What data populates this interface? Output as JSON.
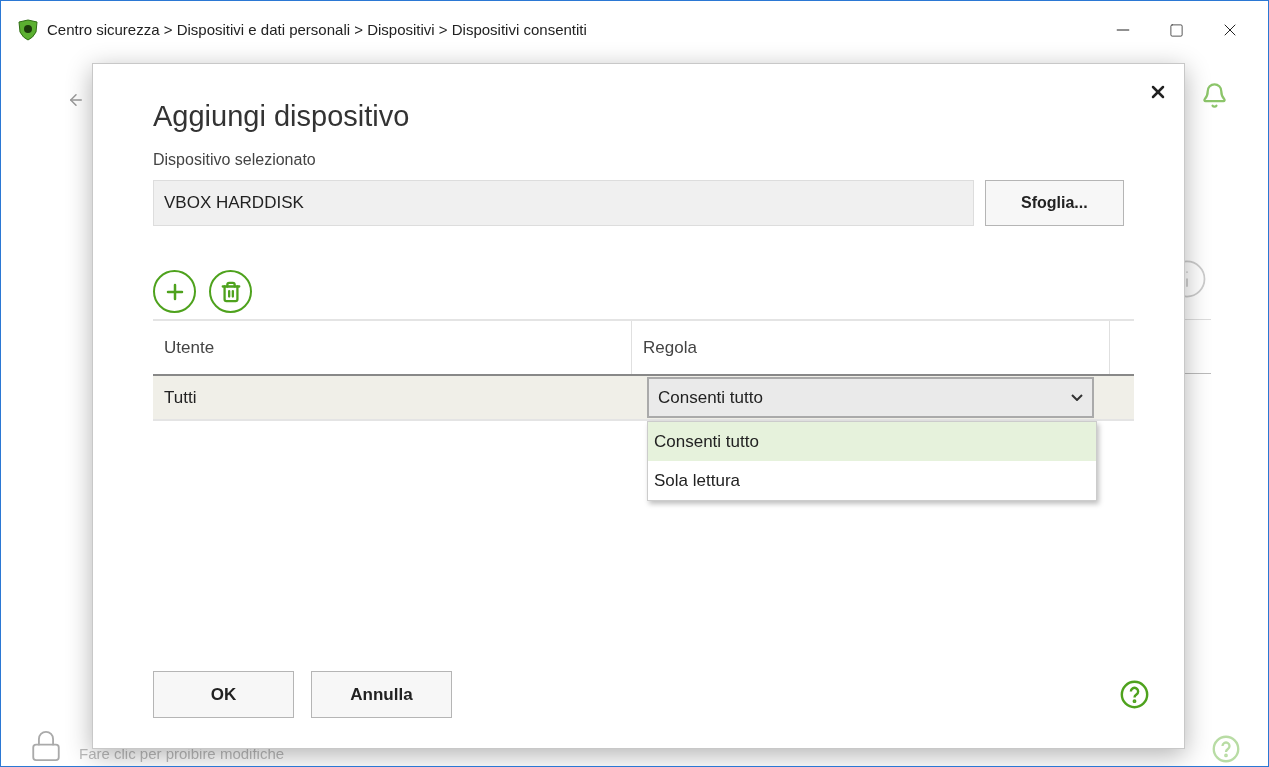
{
  "window": {
    "title": "Centro sicurezza > Dispositivi e dati personali > Dispositivi > Dispositivi consentiti"
  },
  "background": {
    "lock_hint": "Fare clic per proibire modifiche"
  },
  "dialog": {
    "title": "Aggiungi dispositivo",
    "device_label": "Dispositivo selezionato",
    "device_value": "VBOX HARDDISK",
    "browse_button": "Sfoglia...",
    "table": {
      "columns": [
        "Utente",
        "Regola"
      ],
      "rows": [
        {
          "user": "Tutti",
          "rule": "Consenti tutto",
          "expanded": true,
          "options": [
            {
              "label": "Consenti tutto",
              "selected": true
            },
            {
              "label": "Sola lettura",
              "selected": false
            }
          ]
        }
      ]
    },
    "buttons": [
      "OK",
      "Annulla"
    ]
  }
}
